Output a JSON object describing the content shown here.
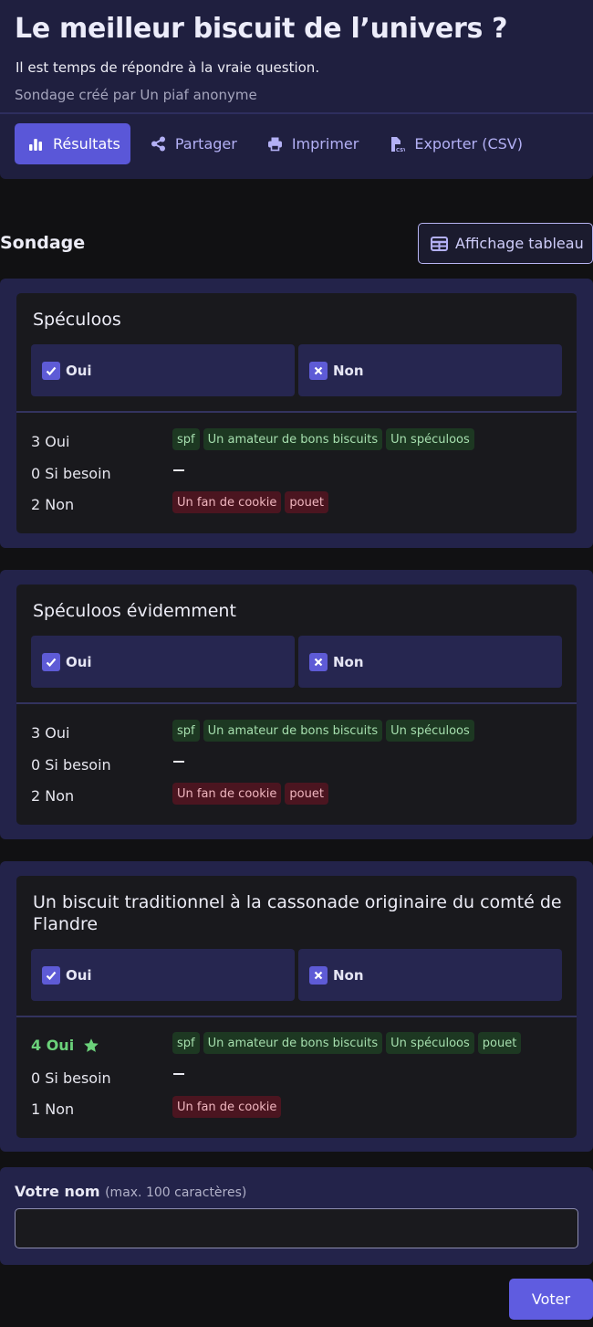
{
  "poll": {
    "title": "Le meilleur biscuit de l’univers ?",
    "subtitle": "Il est temps de répondre à la vraie question.",
    "creator": "Sondage créé par Un piaf anonyme"
  },
  "tabs": [
    {
      "label": "Résultats",
      "icon": "bar-chart-icon",
      "active": true
    },
    {
      "label": "Partager",
      "icon": "share-icon"
    },
    {
      "label": "Imprimer",
      "icon": "printer-icon"
    },
    {
      "label": "Exporter (CSV)",
      "icon": "csv-file-icon"
    }
  ],
  "section": {
    "title": "Sondage",
    "table_view_label": "Affichage tableau"
  },
  "questions": [
    {
      "title": "Spéculoos",
      "choices": [
        "Oui",
        "Non"
      ],
      "results": {
        "yes": {
          "label": "3 Oui",
          "voters": [
            "spf",
            "Un amateur de bons biscuits",
            "Un spéculoos"
          ]
        },
        "maybe": {
          "label": "0 Si besoin",
          "voters": []
        },
        "no": {
          "label": "2 Non",
          "voters": [
            "Un fan de cookie",
            "pouet"
          ]
        }
      }
    },
    {
      "title": "Spéculoos évidemment",
      "choices": [
        "Oui",
        "Non"
      ],
      "results": {
        "yes": {
          "label": "3 Oui",
          "voters": [
            "spf",
            "Un amateur de bons biscuits",
            "Un spéculoos"
          ]
        },
        "maybe": {
          "label": "0 Si besoin",
          "voters": []
        },
        "no": {
          "label": "2 Non",
          "voters": [
            "Un fan de cookie",
            "pouet"
          ]
        }
      }
    },
    {
      "title": "Un biscuit traditionnel à la cassonade originaire du comté de Flandre",
      "choices": [
        "Oui",
        "Non"
      ],
      "results": {
        "yes": {
          "label": "4 Oui",
          "winner": true,
          "voters": [
            "spf",
            "Un amateur de bons biscuits",
            "Un spéculoos",
            "pouet"
          ]
        },
        "maybe": {
          "label": "0 Si besoin",
          "voters": []
        },
        "no": {
          "label": "1 Non",
          "voters": [
            "Un fan de cookie"
          ]
        }
      }
    }
  ],
  "form": {
    "name_label": "Votre nom",
    "name_hint": "(max. 100 caractères)",
    "name_value": "",
    "vote_label": "Voter"
  },
  "colors": {
    "accent": "#5a57d8",
    "header_bg": "#1f1f3f",
    "yes_tag": "#1d3822",
    "no_tag": "#4b1520",
    "winner": "#6bd17a"
  }
}
